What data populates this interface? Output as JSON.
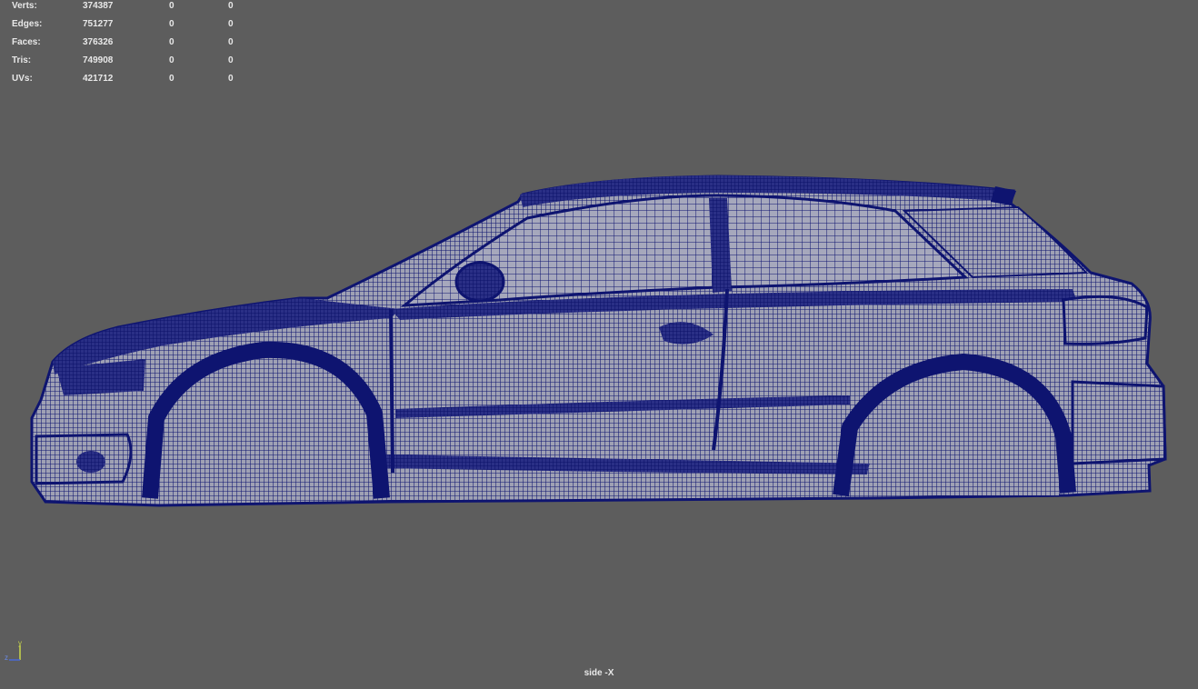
{
  "hud": {
    "rows": [
      {
        "label": "Verts:",
        "total": "374387",
        "selected": "0",
        "component": "0"
      },
      {
        "label": "Edges:",
        "total": "751277",
        "selected": "0",
        "component": "0"
      },
      {
        "label": "Faces:",
        "total": "376326",
        "selected": "0",
        "component": "0"
      },
      {
        "label": "Tris:",
        "total": "749908",
        "selected": "0",
        "component": "0"
      },
      {
        "label": "UVs:",
        "total": "421712",
        "selected": "0",
        "component": "0"
      }
    ]
  },
  "viewport": {
    "camera_label": "side -X",
    "axis": {
      "y": "y",
      "z": "z"
    }
  },
  "colors": {
    "background": "#5d5d5d",
    "wireframe": "#0e1470",
    "mesh_fill": "#9fa1b4",
    "hud_text": "#e8e8e8",
    "axis_y": "#c9d64a",
    "axis_z": "#4a6ad6"
  }
}
